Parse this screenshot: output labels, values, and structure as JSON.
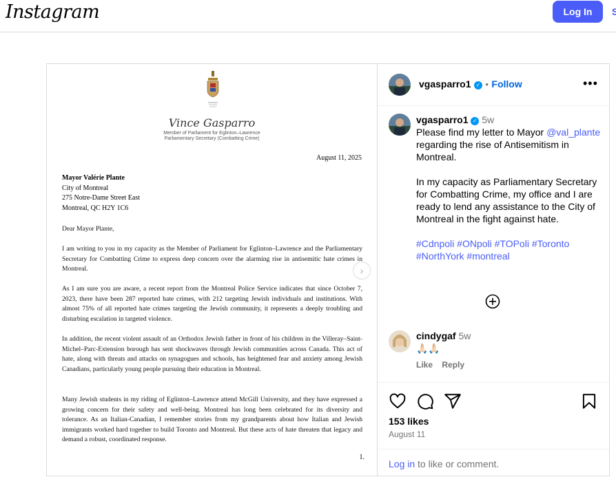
{
  "header": {
    "logo": "Instagram",
    "login_label": "Log In",
    "signup_peek": "S"
  },
  "letter": {
    "mp_name": "Vince Gasparro",
    "mp_line1": "Member of Parliament for Eglinton–Lawrence",
    "mp_line2": "Parliamentary Secretary (Combatting Crime)",
    "date": "August 11, 2025",
    "recipient": "Mayor Valérie Plante",
    "addr1": "City of Montreal",
    "addr2": "275 Notre-Dame Street East",
    "addr3": "Montreal, QC H2Y 1C6",
    "salutation": "Dear Mayor Plante,",
    "p1": "I am writing to you in my capacity as the Member of Parliament for Eglinton–Lawrence and the Parliamentary Secretary for Combatting Crime to express deep concern over the alarming rise in antisemitic hate crimes in Montreal.",
    "p2": "As I am sure you are aware, a recent report from the Montreal Police Service indicates that since October 7, 2023, there have been 287 reported hate crimes, with 212 targeting Jewish individuals and institutions. With almost 75% of all reported hate crimes targeting the Jewish community, it represents a deeply troubling and disturbing escalation in targeted violence.",
    "p3": "In addition, the recent violent assault of an Orthodox Jewish father in front of his children in the Villeray–Saint-Michel–Parc-Extension borough has sent shockwaves through Jewish communities across Canada. This act of hate, along with threats and attacks on synagogues and schools, has heightened fear and anxiety among Jewish Canadians, particularly young people pursuing their education in Montreal.",
    "p4": "Many Jewish students in my riding of Eglinton–Lawrence attend McGill University, and they have expressed a growing concern for their safety and well-being. Montreal has long been celebrated for its diversity and tolerance. As an Italian-Canadian, I remember stories from my grandparents about how Italian and Jewish immigrants worked hard together to build Toronto and Montreal. But these acts of hate threaten that legacy and demand a robust, coordinated response.",
    "page_number": "1."
  },
  "post": {
    "username": "vgasparro1",
    "follow_label": "Follow",
    "dot": "•",
    "caption_time": "5w",
    "caption_intro": "Please find my letter to Mayor",
    "caption_mention": "@val_plante",
    "caption_rest": "regarding the rise of Antisemitism in Montreal.",
    "caption_para2": "In my capacity as Parliamentary Secretary for Combatting Crime, my office and I are ready to lend any assistance to the City of Montreal in the fight against  hate.",
    "hashtags": "#Cdnpoli #ONpoli #TOPoli #Toronto #NorthYork #montreal",
    "comment": {
      "username": "cindygaf",
      "time": "5w",
      "text": "🙏🏻🙏🏻",
      "like_label": "Like",
      "reply_label": "Reply"
    },
    "likes": "153 likes",
    "date": "August 11",
    "login_link": "Log in",
    "login_rest": " to like or comment."
  },
  "colors": {
    "accent": "#4a5df9",
    "border": "#dbdbdb",
    "muted": "#737373",
    "verified": "#0095f6"
  },
  "icons": [
    "heart-icon",
    "comment-icon",
    "share-icon",
    "bookmark-icon",
    "more-icon",
    "add-comment-icon",
    "verified-icon",
    "next-arrow-icon"
  ]
}
